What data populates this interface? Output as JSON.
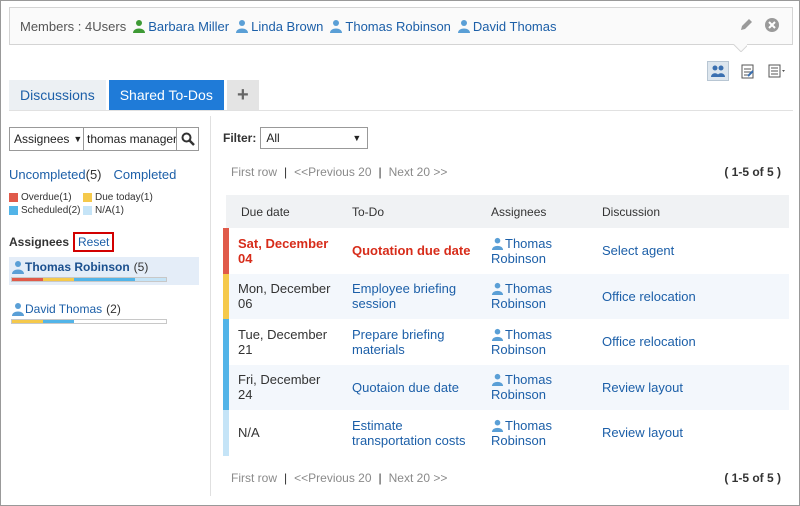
{
  "members": {
    "label": "Members : 4Users",
    "list": [
      {
        "name": "Barbara Miller",
        "icon": "green-user-icon"
      },
      {
        "name": "Linda Brown",
        "icon": "user-icon"
      },
      {
        "name": "Thomas Robinson",
        "icon": "user-icon"
      },
      {
        "name": "David Thomas",
        "icon": "user-icon"
      }
    ]
  },
  "tabs": {
    "discussions": "Discussions",
    "shared_todos": "Shared To-Dos",
    "add": "+"
  },
  "search": {
    "assignee_select": "Assignees",
    "value": "thomas manager"
  },
  "status": {
    "uncompleted_label": "Uncompleted",
    "uncompleted_count": "(5)",
    "completed_label": "Completed"
  },
  "legend": [
    {
      "label": "Overdue",
      "count": "(1)",
      "color": "#e05a4a"
    },
    {
      "label": "Due today",
      "count": "(1)",
      "color": "#f5c94b"
    },
    {
      "label": "Scheduled",
      "count": "(2)",
      "color": "#52b4e8"
    },
    {
      "label": "N/A",
      "count": "(1)",
      "color": "#c5e4f7"
    }
  ],
  "assignees": {
    "title": "Assignees",
    "reset": "Reset",
    "items": [
      {
        "name": "Thomas Robinson",
        "count": "(5)",
        "selected": true,
        "progress": {
          "overdue": 1,
          "due_today": 1,
          "scheduled": 2,
          "na": 1
        }
      },
      {
        "name": "David Thomas",
        "count": "(2)",
        "selected": false,
        "progress": {
          "overdue": 0,
          "due_today": 1,
          "scheduled": 1,
          "na": 0
        }
      }
    ]
  },
  "filter": {
    "label": "Filter:",
    "value": "All"
  },
  "pager": {
    "first": "First row",
    "prev": "<<Previous 20",
    "next": "Next 20 >>",
    "range": "( 1-5 of 5 )",
    "sep": "|"
  },
  "table": {
    "headers": [
      "Due date",
      "To-Do",
      "Assignees",
      "Discussion"
    ],
    "rows": [
      {
        "due": "Sat, December 04",
        "todo": "Quotation due date",
        "assignee": "Thomas Robinson",
        "discussion": "Select agent",
        "status": "overdue"
      },
      {
        "due": "Mon, December 06",
        "todo": "Employee briefing session",
        "assignee": "Thomas Robinson",
        "discussion": "Office relocation",
        "status": "due_today"
      },
      {
        "due": "Tue, December 21",
        "todo": "Prepare briefing materials",
        "assignee": "Thomas Robinson",
        "discussion": "Office relocation",
        "status": "scheduled"
      },
      {
        "due": "Fri, December 24",
        "todo": "Quotaion due date",
        "assignee": "Thomas Robinson",
        "discussion": "Review layout",
        "status": "scheduled"
      },
      {
        "due": "N/A",
        "todo": "Estimate transportation costs",
        "assignee": "Thomas Robinson",
        "discussion": "Review layout",
        "status": "na"
      }
    ]
  },
  "colors": {
    "overdue": "#e05a4a",
    "due_today": "#f5c94b",
    "scheduled": "#52b4e8",
    "na": "#c5e4f7",
    "accent": "#1f7bd8"
  }
}
